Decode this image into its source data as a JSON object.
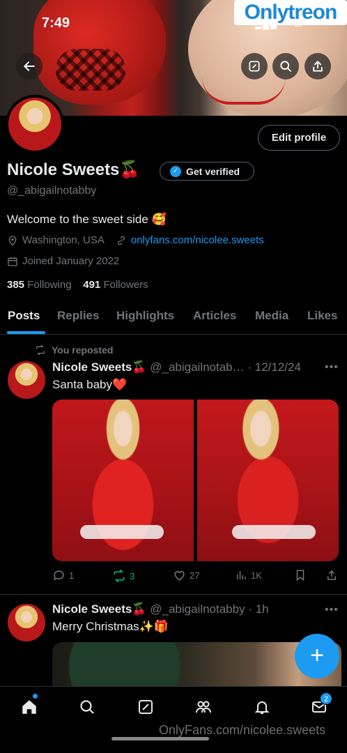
{
  "status": {
    "time": "7:49",
    "watermark": "Onlytreon"
  },
  "header": {
    "back_icon": "arrow-left-icon",
    "actions": [
      "compose-icon",
      "search-icon",
      "share-icon"
    ]
  },
  "profile": {
    "name": "Nicole Sweets🍒",
    "handle": "@_abigailnotabby",
    "edit_label": "Edit profile",
    "verify_label": "Get verified",
    "bio": "Welcome to the sweet side 🥰",
    "location": "Washington, USA",
    "link": "onlyfans.com/nicolee.sweets",
    "joined": "Joined January 2022",
    "following_count": "385",
    "following_label": "Following",
    "followers_count": "491",
    "followers_label": "Followers"
  },
  "tabs": [
    "Posts",
    "Replies",
    "Highlights",
    "Articles",
    "Media",
    "Likes"
  ],
  "active_tab": "Posts",
  "posts": [
    {
      "repost_note": "You reposted",
      "name": "Nicole Sweets🍒",
      "meta": "@_abigailnotab… · 12/12/24",
      "text": "Santa baby❤️",
      "replies": "1",
      "reposts": "3",
      "likes": "27",
      "views": "1K"
    },
    {
      "name": "Nicole Sweets🍒",
      "meta": "@_abigailnotabby · 1h",
      "text": "Merry Christmas✨🎁"
    }
  ],
  "fab_label": "+",
  "bottom_nav": {
    "items": [
      "home-icon",
      "search-icon",
      "grok-icon",
      "communities-icon",
      "notifications-icon",
      "messages-icon"
    ],
    "messages_badge": "2",
    "watermark": "OnlyFans.com/nicolee.sweets"
  },
  "colors": {
    "accent": "#1d9bf0",
    "repost_green": "#00ba7c",
    "muted": "#71767b",
    "text": "#e7e9ea",
    "background": "#000000"
  }
}
